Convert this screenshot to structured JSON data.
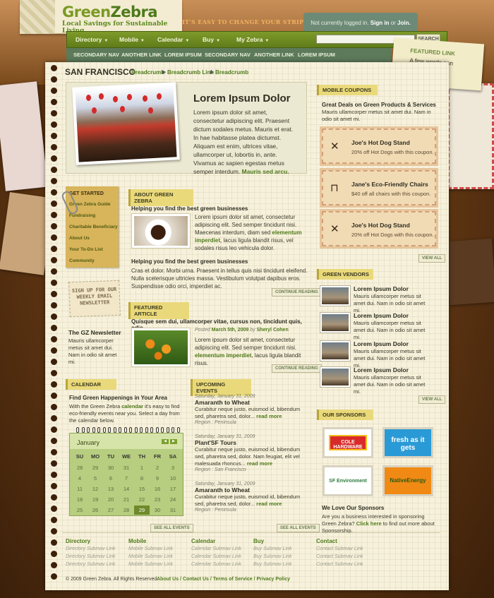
{
  "brand": {
    "name_a": "Green",
    "name_b": "Zebra",
    "subtitle": "Local Savings for Sustainable Living",
    "tagline": "IT'S EASY TO CHANGE YOUR STRIPES!"
  },
  "login": {
    "text": "Not currently logged in.",
    "signin": "Sign in",
    "or": "or",
    "join": "Join."
  },
  "nav": {
    "items": [
      "Directory",
      "Mobile",
      "Calendar",
      "Buy",
      "My Zebra"
    ],
    "search_button": "SEARCH",
    "search_placeholder": ""
  },
  "subnav": [
    "SECONDARY NAV",
    "ANOTHER LINK",
    "LOREM IPSUM",
    "SECONDARY NAV",
    "ANOTHER LINK",
    "LOREM IPSUM"
  ],
  "featured_link": {
    "title": "FEATURED LINK",
    "text": "A few words can go here."
  },
  "breadcrumb": {
    "city": "SAN FRANCISCO",
    "items": [
      "Breadcrumb",
      "Breadcrumb Link",
      "Breadcrumb"
    ]
  },
  "feature": {
    "title": "Lorem Ipsum Dolor",
    "text": "Lorem ipsum dolor sit amet, consectetur adipiscing elit. Praesent dictum sodales metus. Mauris et erat. In hae habitasse platea dictumst. Aliquam est enim, ultrices vitae, ullamcorper ut, lobortis in, ante. Vivamus ac sapien egestas metus semper interdum.",
    "link": "Mauris sed arcu."
  },
  "get_started": {
    "title": "GET STARTED",
    "items": [
      "Green Zebra Guide",
      "Fundraising",
      "Charitable Beneficiary",
      "About Us",
      "Your To-Do List",
      "Community"
    ]
  },
  "signup": "SIGN UP FOR OUR WEEKLY EMAIL NEWSLETTER",
  "newsletter": {
    "title": "The GZ Newsletter",
    "text": "Mauris ullamcorper metus sit amet dui. Nam in odio sit amet mi."
  },
  "about": {
    "label": "ABOUT GREEN ZEBRA",
    "h1": "Helping you find the best green businesses",
    "p1a": "Lorem ipsum dolor sit amet, consectetur adipiscing elit. Sed semper tincidunt nisi. Maecenas interdum, diam sed",
    "p1link": "elementum imperdiet",
    "p1b": ", lacus ligula blandit risus, vel sodales risus leo vehicula dolor.",
    "h2": "Helping you find the best green businesses",
    "p2": "Cras et dolor. Morbi urna. Praesent in tellus quis nisi tincidunt eleifend. Nulla scelerisque ultricies massa. Vestibulum volutpat dapibus eros. Suspendisse odio orci, imperdiet ac.",
    "more": "CONTINUE READING"
  },
  "article": {
    "label": "FEATURED ARTICLE",
    "title": "Quisque sem dui, ullamcorper vitae, cursus non, tincidunt quis, odio",
    "posted": "Posted",
    "date": "March 5th, 2009",
    "by": "by",
    "author": "Sheryl Cohen",
    "pa": "Lorem ipsum dolor sit amet, consectetur adipiscing elit. Sed semper tincidunt nisi.",
    "plink": "elementum imperdiet",
    "pb": ", lacus ligula blandit risus.",
    "more": "CONTINUE READING"
  },
  "coupons": {
    "label": "MOBILE COUPONS",
    "title": "Great Deals on Green Products & Services",
    "text": "Mauris ullamcorper metus sit amet dui. Nam in odio sit amet mi.",
    "items": [
      {
        "title": "Joe's Hot Dog Stand",
        "text": "20% off Hot Dogs with this coupon.",
        "icon": "cutlery-icon"
      },
      {
        "title": "Jane's Eco-Friendly Chairs",
        "text": "$40 off all chairs with this coupon.",
        "icon": "chair-icon"
      },
      {
        "title": "Joe's Hot Dog Stand",
        "text": "20% off Hot Dogs with this coupon.",
        "icon": "cutlery-icon"
      }
    ],
    "view_all": "VIEW ALL"
  },
  "vendors": {
    "label": "GREEN VENDORS",
    "items": [
      {
        "title": "Lorem Ipsum Dolor",
        "text": "Mauris ullamcorper metus sit amet dui. Nam in odio sit amet mi."
      },
      {
        "title": "Lorem Ipsum Dolor",
        "text": "Mauris ullamcorper metus sit amet dui. Nam in odio sit amet mi."
      },
      {
        "title": "Lorem Ipsum Dolor",
        "text": "Mauris ullamcorper metus sit amet dui. Nam in odio sit amet mi."
      },
      {
        "title": "Lorem Ipsum Dolor",
        "text": "Mauris ullamcorper metus sit amet dui. Nam in odio sit amet mi."
      }
    ],
    "view_all": "VIEW ALL"
  },
  "sponsors": {
    "label": "OUR SPONSORS",
    "logos": [
      "COLE HARDWARE",
      "fresh as it gets",
      "SF Environment",
      "NativeEnergy"
    ],
    "title": "We Love Our Sponsors",
    "text_a": "Are you a business interested in sponsoring Green Zebra?",
    "link": "Click here",
    "text_b": "to find out more about Sponsorship."
  },
  "calendar": {
    "label": "CALENDAR",
    "title": "Find Green Happenings in Your Area",
    "text_a": "With the Green Zebra",
    "link": "calendar",
    "text_b": "it's easy to find eco-friendly events near you. Select a day from the calendar below.",
    "month": "January",
    "dow": [
      "SU",
      "MO",
      "TU",
      "WE",
      "TH",
      "FR",
      "SA"
    ],
    "weeks": [
      [
        "28",
        "29",
        "30",
        "31",
        "1",
        "2",
        "3"
      ],
      [
        "4",
        "5",
        "6",
        "7",
        "8",
        "9",
        "10"
      ],
      [
        "11",
        "12",
        "13",
        "14",
        "15",
        "16",
        "17"
      ],
      [
        "18",
        "19",
        "20",
        "21",
        "22",
        "23",
        "24"
      ],
      [
        "25",
        "26",
        "27",
        "28",
        "29",
        "30",
        "31"
      ]
    ],
    "selected": "29",
    "see_all": "SEE ALL EVENTS"
  },
  "events": {
    "label": "UPCOMING EVENTS",
    "items": [
      {
        "date": "Saturday, January 31, 2009",
        "title": "Amaranth to Wheat",
        "text": "Curabitur neque justo, euismod id, bibendum sed, pharetra sed, dolor...",
        "more": "read more",
        "region": "Region : Peninsula"
      },
      {
        "date": "Saturday, January 31, 2009",
        "title": "Plant'SF Tours",
        "text": "Curabitur neque justo, euismod id, bibendum sed, pharetra sed, dolor. Nam feugiat, elit vel malesuada rhoncus...",
        "more": "read more",
        "region": "Region : San Francisco"
      },
      {
        "date": "Saturday, January 31, 2009",
        "title": "Amaranth to Wheat",
        "text": "Curabitur neque justo, euismod id, bibendum sed, pharetra sed, dolor...",
        "more": "read more",
        "region": "Region : Peninsula"
      }
    ],
    "see_all": "SEE ALL EVENTS"
  },
  "footer": {
    "cols": [
      {
        "title": "Directory",
        "links": [
          "Directory Submav Link",
          "Directory Submav Link",
          "Directory Submav Link"
        ]
      },
      {
        "title": "Mobile",
        "links": [
          "Mobile Submav Link",
          "Mobile Submav Link",
          "Mobile Submav Link"
        ]
      },
      {
        "title": "Calendar",
        "links": [
          "Calendar Submav Link",
          "Calendar Submav Link",
          "Calendar Submav Link"
        ]
      },
      {
        "title": "Buy",
        "links": [
          "Buy Submav Link",
          "Buy Submav Link",
          "Buy Submav Link"
        ]
      },
      {
        "title": "Contact",
        "links": [
          "Contact Submav Link",
          "Contact Submav Link",
          "Contact Submav Link"
        ]
      }
    ],
    "copyright": "© 2009 Green Zebra. All Rights Reserved.",
    "links": [
      "About Us",
      "Contact Us",
      "Terms of Service",
      "Privacy Policy"
    ]
  }
}
